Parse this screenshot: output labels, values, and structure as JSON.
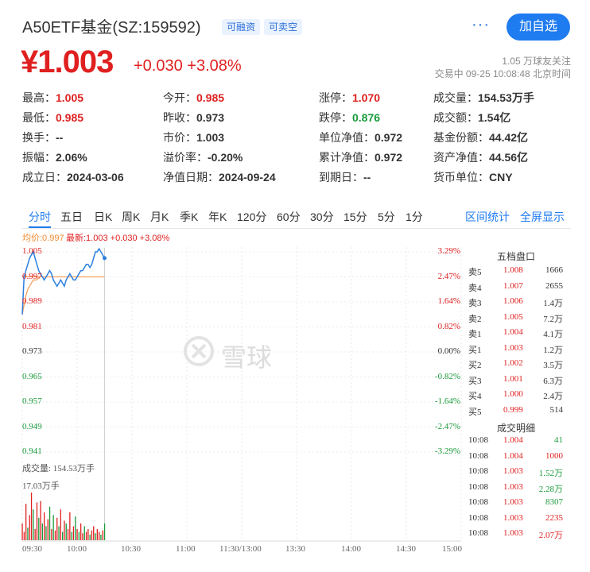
{
  "header": {
    "title": "A50ETF基金(SZ:159592)",
    "tags": [
      "可融资",
      "可卖空"
    ],
    "more_label": "···",
    "add_label": "加自选"
  },
  "quote": {
    "price": "¥1.003",
    "change": "+0.030 +3.08%",
    "followers": "1.05 万球友关注",
    "status": "交易中 09-25 10:08:48 北京时间"
  },
  "stats": [
    [
      {
        "label": "最高：",
        "value": "1.005",
        "color": "red"
      },
      {
        "label": "今开：",
        "value": "0.985",
        "color": "red"
      },
      {
        "label": "涨停：",
        "value": "1.070",
        "color": "red"
      },
      {
        "label": "成交量：",
        "value": "154.53万手",
        "color": ""
      }
    ],
    [
      {
        "label": "最低：",
        "value": "0.985",
        "color": "red"
      },
      {
        "label": "昨收：",
        "value": "0.973",
        "color": ""
      },
      {
        "label": "跌停：",
        "value": "0.876",
        "color": "green"
      },
      {
        "label": "成交额：",
        "value": "1.54亿",
        "color": ""
      }
    ],
    [
      {
        "label": "换手：",
        "value": "--",
        "color": ""
      },
      {
        "label": "市价：",
        "value": "1.003",
        "color": ""
      },
      {
        "label": "单位净值：",
        "value": "0.972",
        "color": ""
      },
      {
        "label": "基金份额：",
        "value": "44.42亿",
        "color": ""
      }
    ],
    [
      {
        "label": "振幅：",
        "value": "2.06%",
        "color": ""
      },
      {
        "label": "溢价率：",
        "value": "-0.20%",
        "color": ""
      },
      {
        "label": "累计净值：",
        "value": "0.972",
        "color": ""
      },
      {
        "label": "资产净值：",
        "value": "44.56亿",
        "color": ""
      }
    ],
    [
      {
        "label": "成立日：",
        "value": "2024-03-06",
        "color": ""
      },
      {
        "label": "净值日期：",
        "value": "2024-09-24",
        "color": ""
      },
      {
        "label": "到期日：",
        "value": "--",
        "color": ""
      },
      {
        "label": "货币单位：",
        "value": "CNY",
        "color": ""
      }
    ]
  ],
  "tabs": [
    "分时",
    "五日",
    "日K",
    "周K",
    "月K",
    "季K",
    "年K",
    "120分",
    "60分",
    "30分",
    "15分",
    "5分",
    "1分"
  ],
  "tabs_right": [
    "区间统计",
    "全屏显示"
  ],
  "chart_top": {
    "avg": "均价:0.997",
    "latest": "最新:1.003 +0.030 +3.08%"
  },
  "watermark": "雪球",
  "chart_data": {
    "type": "line",
    "y_ticks": [
      "1.005",
      "0.997",
      "0.989",
      "0.981",
      "0.973",
      "0.965",
      "0.957",
      "0.949",
      "0.941"
    ],
    "pct_ticks": [
      "3.29%",
      "2.47%",
      "1.64%",
      "0.82%",
      "0.00%",
      "-0.82%",
      "-1.64%",
      "-2.47%",
      "-3.29%"
    ],
    "x_ticks": [
      "09:30",
      "10:00",
      "10:30",
      "11:00",
      "11:30/13:00",
      "13:30",
      "14:00",
      "14:30",
      "15:00"
    ],
    "ylim": [
      0.941,
      1.005
    ],
    "base": 0.973,
    "total_minutes": 240,
    "series": [
      {
        "name": "最新",
        "values": [
          0.985,
          0.997,
          0.999,
          1.001,
          1.003,
          1.004,
          1.005,
          1.003,
          1.001,
          0.999,
          0.998,
          0.997,
          0.996,
          0.997,
          0.998,
          0.999,
          0.998,
          0.996,
          0.995,
          0.994,
          0.995,
          0.996,
          0.995,
          0.994,
          0.996,
          0.997,
          0.998,
          0.997,
          0.996,
          0.996,
          0.997,
          0.998,
          0.999,
          0.999,
          1.0,
          1.001,
          1.001,
          1.0,
          1.001,
          1.003,
          1.005,
          1.005,
          1.006,
          1.005,
          1.004,
          1.003
        ]
      },
      {
        "name": "均价",
        "values": [
          0.985,
          0.988,
          0.991,
          0.993,
          0.994,
          0.995,
          0.996,
          0.996,
          0.996,
          0.997,
          0.997,
          0.997,
          0.997,
          0.997,
          0.997,
          0.997,
          0.997,
          0.997,
          0.997,
          0.997,
          0.997,
          0.997,
          0.997,
          0.997,
          0.997,
          0.997,
          0.997,
          0.997,
          0.997,
          0.997,
          0.997,
          0.997,
          0.997,
          0.997,
          0.997,
          0.997,
          0.997,
          0.997,
          0.997,
          0.997,
          0.997,
          0.997,
          0.997,
          0.997,
          0.997,
          0.997
        ]
      }
    ],
    "volume_label": "成交量: 154.53万手",
    "volume_max_label": "17.03万手",
    "volume_max": 17.03,
    "volume": [
      {
        "v": 6.0,
        "c": "red"
      },
      {
        "v": 3.0,
        "c": "red"
      },
      {
        "v": 13.0,
        "c": "red"
      },
      {
        "v": 4.5,
        "c": "green"
      },
      {
        "v": 9.0,
        "c": "red"
      },
      {
        "v": 17.03,
        "c": "red"
      },
      {
        "v": 11.0,
        "c": "green"
      },
      {
        "v": 4.0,
        "c": "red"
      },
      {
        "v": 13.5,
        "c": "red"
      },
      {
        "v": 8.0,
        "c": "green"
      },
      {
        "v": 14.0,
        "c": "red"
      },
      {
        "v": 6.0,
        "c": "green"
      },
      {
        "v": 10.0,
        "c": "red"
      },
      {
        "v": 5.0,
        "c": "green"
      },
      {
        "v": 7.5,
        "c": "red"
      },
      {
        "v": 12.0,
        "c": "green"
      },
      {
        "v": 4.0,
        "c": "red"
      },
      {
        "v": 9.0,
        "c": "green"
      },
      {
        "v": 3.5,
        "c": "red"
      },
      {
        "v": 8.0,
        "c": "red"
      },
      {
        "v": 5.0,
        "c": "green"
      },
      {
        "v": 11.0,
        "c": "red"
      },
      {
        "v": 3.0,
        "c": "green"
      },
      {
        "v": 7.0,
        "c": "red"
      },
      {
        "v": 6.0,
        "c": "green"
      },
      {
        "v": 4.0,
        "c": "red"
      },
      {
        "v": 10.0,
        "c": "red"
      },
      {
        "v": 3.0,
        "c": "green"
      },
      {
        "v": 5.0,
        "c": "red"
      },
      {
        "v": 8.5,
        "c": "green"
      },
      {
        "v": 4.0,
        "c": "red"
      },
      {
        "v": 3.0,
        "c": "green"
      },
      {
        "v": 6.0,
        "c": "red"
      },
      {
        "v": 2.5,
        "c": "red"
      },
      {
        "v": 5.0,
        "c": "green"
      },
      {
        "v": 3.0,
        "c": "red"
      },
      {
        "v": 4.0,
        "c": "red"
      },
      {
        "v": 2.0,
        "c": "green"
      },
      {
        "v": 3.5,
        "c": "red"
      },
      {
        "v": 5.0,
        "c": "red"
      },
      {
        "v": 2.5,
        "c": "green"
      },
      {
        "v": 4.0,
        "c": "red"
      },
      {
        "v": 3.0,
        "c": "red"
      },
      {
        "v": 2.0,
        "c": "green"
      },
      {
        "v": 3.5,
        "c": "red"
      },
      {
        "v": 6.0,
        "c": "green"
      }
    ]
  },
  "order_book": {
    "title": "五档盘口",
    "rows": [
      {
        "label": "卖5",
        "price": "1.008",
        "vol": "1666"
      },
      {
        "label": "卖4",
        "price": "1.007",
        "vol": "2655"
      },
      {
        "label": "卖3",
        "price": "1.006",
        "vol": "1.4万"
      },
      {
        "label": "卖2",
        "price": "1.005",
        "vol": "7.2万"
      },
      {
        "label": "卖1",
        "price": "1.004",
        "vol": "4.1万"
      },
      {
        "label": "买1",
        "price": "1.003",
        "vol": "1.2万"
      },
      {
        "label": "买2",
        "price": "1.002",
        "vol": "3.5万"
      },
      {
        "label": "买3",
        "price": "1.001",
        "vol": "6.3万"
      },
      {
        "label": "买4",
        "price": "1.000",
        "vol": "2.4万"
      },
      {
        "label": "买5",
        "price": "0.999",
        "vol": "514"
      }
    ]
  },
  "trades": {
    "title": "成交明细",
    "rows": [
      {
        "time": "10:08",
        "price": "1.004",
        "vol": "41",
        "color": "green"
      },
      {
        "time": "10:08",
        "price": "1.004",
        "vol": "1000",
        "color": "red"
      },
      {
        "time": "10:08",
        "price": "1.003",
        "vol": "1.52万",
        "color": "green"
      },
      {
        "time": "10:08",
        "price": "1.003",
        "vol": "2.28万",
        "color": "green"
      },
      {
        "time": "10:08",
        "price": "1.003",
        "vol": "8307",
        "color": "green"
      },
      {
        "time": "10:08",
        "price": "1.003",
        "vol": "2235",
        "color": "red"
      },
      {
        "time": "10:08",
        "price": "1.003",
        "vol": "2.07万",
        "color": "red"
      }
    ]
  },
  "colors": {
    "up": "#e02020",
    "down": "#1a9a3a",
    "accent": "#1f7bf0",
    "avg_line": "#f5a05a",
    "price_line": "#2b7fe0"
  }
}
